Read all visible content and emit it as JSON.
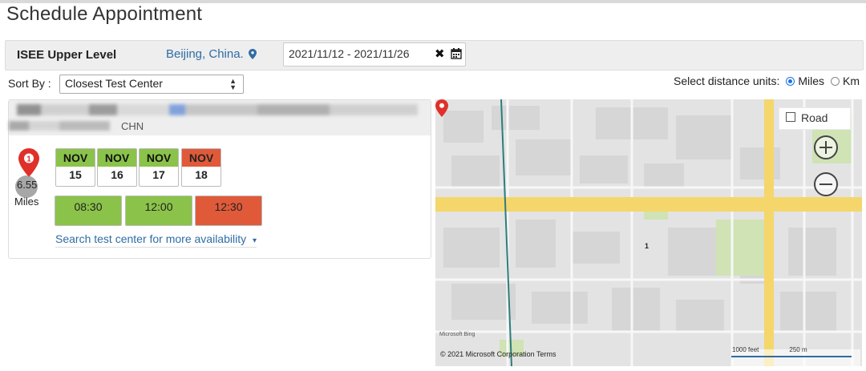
{
  "page": {
    "title": "Schedule Appointment"
  },
  "criteria": {
    "exam": "ISEE Upper Level",
    "location": "Beijing, China.",
    "location_icon": "map-marker-icon",
    "date_range": "2021/11/12 - 2021/11/26",
    "clear_symbol": "✖",
    "calendar_icon": "calendar-icon"
  },
  "sort": {
    "label": "Sort By :",
    "selected": "Closest Test Center"
  },
  "units": {
    "label": "Select distance units:",
    "options": [
      "Miles",
      "Km"
    ],
    "selected": "Miles"
  },
  "result": {
    "address_suffix": "CHN",
    "pin_number": "1",
    "distance": "6.55",
    "distance_unit": "Miles",
    "dates": [
      {
        "month": "NOV",
        "day": "15",
        "status": "available"
      },
      {
        "month": "NOV",
        "day": "16",
        "status": "available"
      },
      {
        "month": "NOV",
        "day": "17",
        "status": "available"
      },
      {
        "month": "NOV",
        "day": "18",
        "status": "selected"
      }
    ],
    "times": [
      {
        "label": "08:30",
        "status": "available"
      },
      {
        "label": "12:00",
        "status": "available"
      },
      {
        "label": "12:30",
        "status": "selected"
      }
    ],
    "more_link": "Search test center for more availability",
    "more_caret": "▾"
  },
  "map": {
    "mode_button": "Road",
    "pin_label": "1",
    "provider_logo": "Microsoft Bing",
    "copyright": "© 2021 Microsoft Corporation",
    "terms": "Terms",
    "scale_feet": "1000 feet",
    "scale_meters": "250 m"
  },
  "colors": {
    "available": "#8bc34a",
    "selected": "#e05a3a",
    "link": "#2e6da4",
    "pin": "#e0302a"
  }
}
